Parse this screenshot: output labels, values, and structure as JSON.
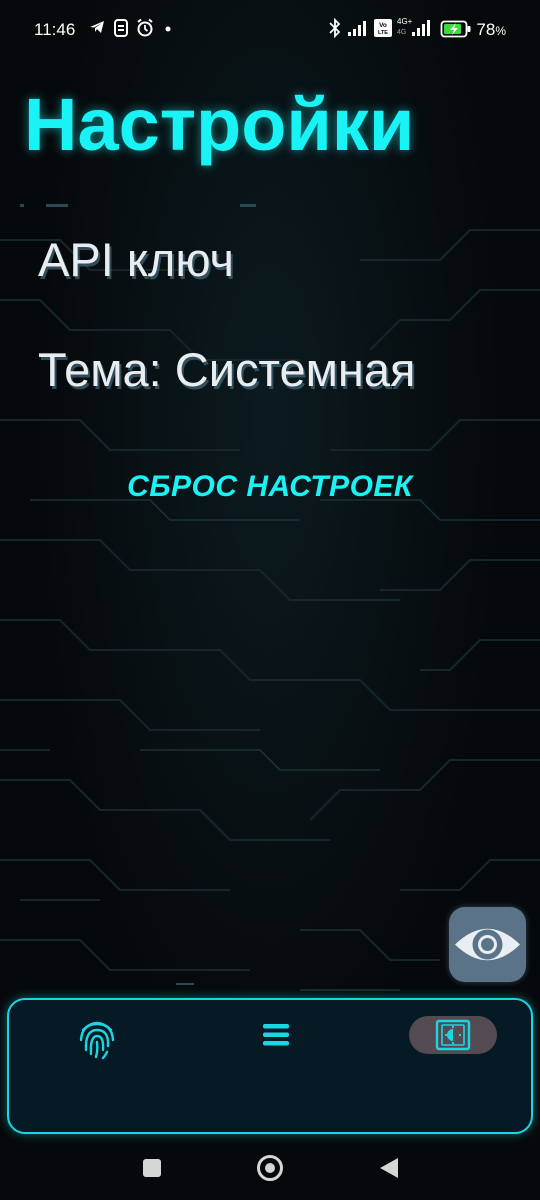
{
  "status_bar": {
    "time": "11:46",
    "battery_percent": "78",
    "battery_suffix": "%",
    "icons": [
      "telegram-icon",
      "sync-icon",
      "alarm-icon",
      "dot-icon",
      "bluetooth-icon",
      "signal-icon",
      "volte-icon",
      "signal-4g-icon",
      "battery-charging-icon"
    ]
  },
  "page": {
    "title": "Настройки",
    "api_key_label": "API ключ",
    "theme_label": "Тема: Системная",
    "reset_label": "СБРОС НАСТРОЕК"
  },
  "fab": {
    "icon": "eye-icon"
  },
  "bottom_nav": {
    "items": [
      {
        "icon": "fingerprint-icon"
      },
      {
        "icon": "menu-icon"
      },
      {
        "icon": "settings-icon",
        "active": true
      }
    ]
  },
  "system_nav": {
    "icons": [
      "recents-icon",
      "home-icon",
      "back-icon"
    ]
  },
  "colors": {
    "accent": "#19f3f5",
    "background": "#06090b",
    "nav_border": "#1ad6e3",
    "fab": "#5a7389",
    "active_tab": "#544b52"
  }
}
